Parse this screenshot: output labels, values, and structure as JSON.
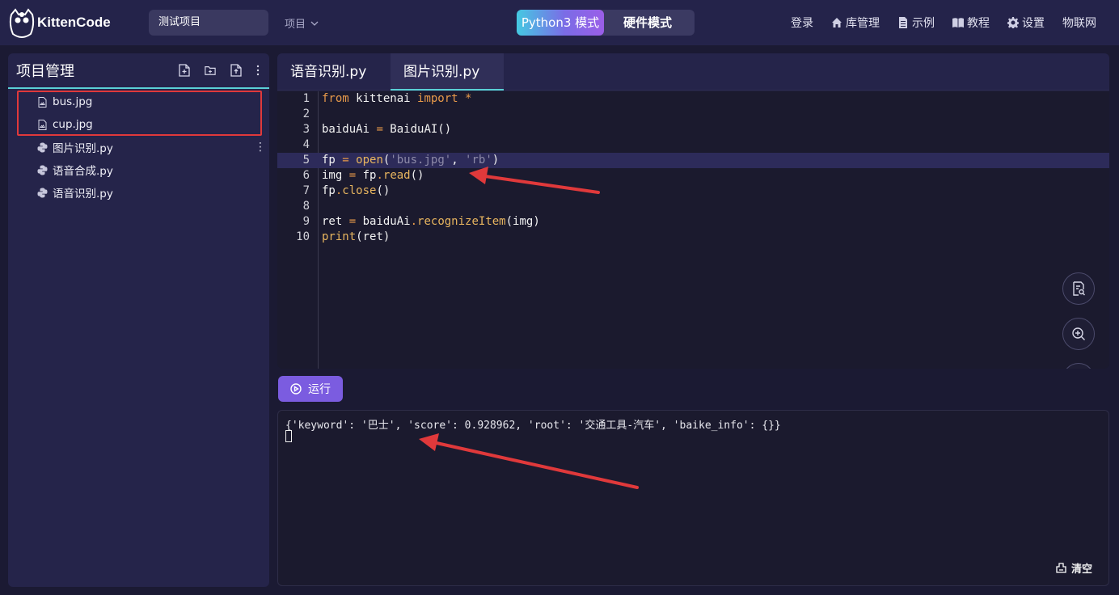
{
  "app": {
    "logo_text": "KittenCode"
  },
  "header": {
    "project_name": "测试项目",
    "project_menu_label": "项目",
    "modes": [
      "Python3 模式",
      "硬件模式"
    ],
    "nav": [
      {
        "label": "登录",
        "icon": ""
      },
      {
        "label": "库管理",
        "icon": "home-icon"
      },
      {
        "label": "示例",
        "icon": "document-icon"
      },
      {
        "label": "教程",
        "icon": "book-icon"
      },
      {
        "label": "设置",
        "icon": "gear-icon"
      },
      {
        "label": "物联网",
        "icon": ""
      }
    ]
  },
  "sidebar": {
    "title": "项目管理",
    "files": [
      {
        "name": "bus.jpg",
        "type": "image"
      },
      {
        "name": "cup.jpg",
        "type": "image"
      },
      {
        "name": "图片识别.py",
        "type": "python"
      },
      {
        "name": "语音合成.py",
        "type": "python"
      },
      {
        "name": "语音识别.py",
        "type": "python"
      }
    ]
  },
  "editor": {
    "tabs": [
      "语音识别.py",
      "图片识别.py"
    ],
    "active_tab": "图片识别.py",
    "current_line": 5,
    "line_numbers": [
      "1",
      "2",
      "3",
      "4",
      "5",
      "6",
      "7",
      "8",
      "9",
      "10"
    ],
    "code_lines": [
      "from kittenai import *",
      "",
      "baiduAi = BaiduAI()",
      "",
      "fp = open('bus.jpg', 'rb')",
      "img = fp.read()",
      "fp.close()",
      "",
      "ret = baiduAi.recognizeItem(img)",
      "print(ret)"
    ]
  },
  "run": {
    "label": "运行"
  },
  "console": {
    "output": "{'keyword': '巴士', 'score': 0.928962, 'root': '交通工具-汽车', 'baike_info': {}}",
    "clear_label": "清空"
  },
  "colors": {
    "accent_purple": "#7b5ce0",
    "accent_teal": "#5ad0d6",
    "annotation_red": "#e0393b"
  }
}
